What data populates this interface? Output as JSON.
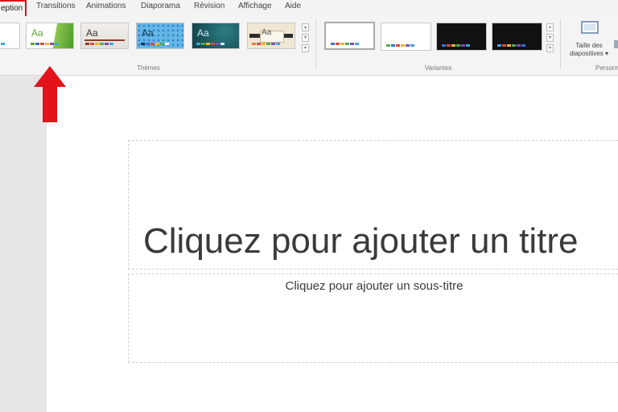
{
  "tabs": [
    {
      "label": "eption",
      "active": true
    },
    {
      "label": "Transitions"
    },
    {
      "label": "Animations"
    },
    {
      "label": "Diaporama"
    },
    {
      "label": "Révision"
    },
    {
      "label": "Affichage"
    },
    {
      "label": "Aide"
    }
  ],
  "themes": {
    "group_label": "Thèmes",
    "items": [
      {
        "icon": "theme-thumbnail-white"
      },
      {
        "icon": "theme-thumbnail-green",
        "glyph": "Aa"
      },
      {
        "icon": "theme-thumbnail-gray",
        "glyph": "Aa"
      },
      {
        "icon": "theme-thumbnail-blue-pattern",
        "glyph": "Aa"
      },
      {
        "icon": "theme-thumbnail-teal",
        "glyph": "Aa"
      },
      {
        "icon": "theme-thumbnail-beige",
        "glyph": "Aa"
      }
    ]
  },
  "variants": {
    "group_label": "Variantes",
    "items": [
      {
        "icon": "variant-thumbnail-white"
      },
      {
        "icon": "variant-thumbnail-white-2"
      },
      {
        "icon": "variant-thumbnail-black"
      },
      {
        "icon": "variant-thumbnail-black-2"
      }
    ]
  },
  "customize": {
    "group_label": "Personn",
    "slide_size_line1": "Taille des",
    "slide_size_line2": "diapositives ▾",
    "icon": "slide-size-icon"
  },
  "slide": {
    "title_placeholder": "Cliquez pour ajouter un titre",
    "subtitle_placeholder": "Cliquez pour ajouter un sous-titre"
  },
  "colors": {
    "accent_red": "#d8131a",
    "palette": [
      "#3b6fd6",
      "#d84a3a",
      "#f2b531",
      "#58a84c",
      "#7a4fb3",
      "#3fa8d8"
    ]
  }
}
